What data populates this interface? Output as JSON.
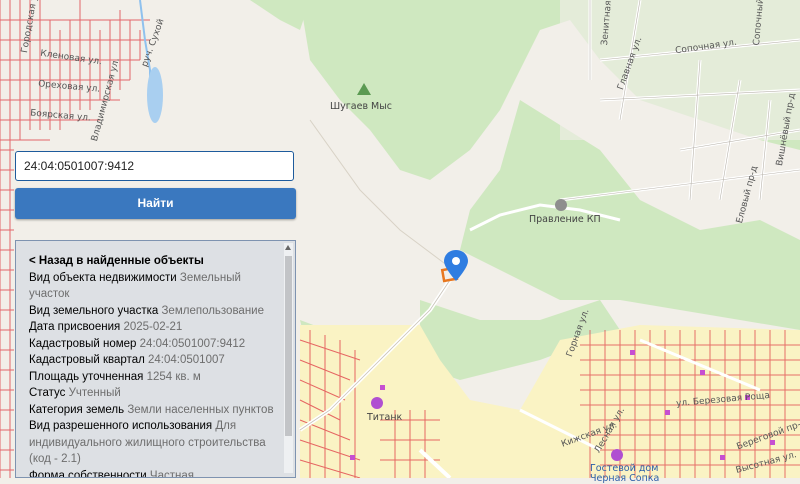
{
  "map": {
    "street_labels": [
      "Городская ул.",
      "Кленовая ул.",
      "Ореховая ул.",
      "Боярская ул.",
      "Владимирская ул.",
      "руч. Сухой",
      "Зенитная ул.",
      "Главная ул.",
      "Сопочная ул.",
      "Сопочный пр-д",
      "Вишнёвый пр-д",
      "Еловый пр-д",
      "Горная ул.",
      "Кижская ул.",
      "Лесная ул.",
      "ул. Березовая Роща",
      "Высотная ул.",
      "Береговой пр-д"
    ],
    "poi_labels": {
      "peak": "Шугаев Мыс",
      "admin": "Правление КП",
      "titan": "Титанк",
      "guest_house": "Гостевой дом",
      "guest_house2": "Черная Сопка"
    },
    "colors": {
      "forest": "#cfe8c0",
      "land": "#f2efe9",
      "residential": "#faf3c4",
      "parcel": "#e0434a",
      "water": "#a9cff0",
      "marker": "#2f7de1",
      "selected": "#e8771f"
    }
  },
  "search": {
    "value": "24:04:0501007:9412"
  },
  "find_button": {
    "label": "Найти"
  },
  "panel": {
    "back_link": "< Назад в найденные объекты",
    "rows": [
      {
        "label": "Вид объекта недвижимости",
        "value": "Земельный участок"
      },
      {
        "label": "Вид земельного участка",
        "value": "Землепользование"
      },
      {
        "label": "Дата присвоения",
        "value": "2025-02-21"
      },
      {
        "label": "Кадастровый номер",
        "value": "24:04:0501007:9412"
      },
      {
        "label": "Кадастровый квартал",
        "value": "24:04:0501007"
      },
      {
        "label": "Площадь уточненная",
        "value": "1254 кв. м"
      },
      {
        "label": "Статус",
        "value": "Учтенный"
      },
      {
        "label": "Категория земель",
        "value": "Земли населенных пунктов"
      },
      {
        "label": "Вид разрешенного использования",
        "value": "Для индивидуального жилищного строительства (код - 2.1)"
      },
      {
        "label": "Форма собственности",
        "value": "Частная"
      }
    ]
  }
}
